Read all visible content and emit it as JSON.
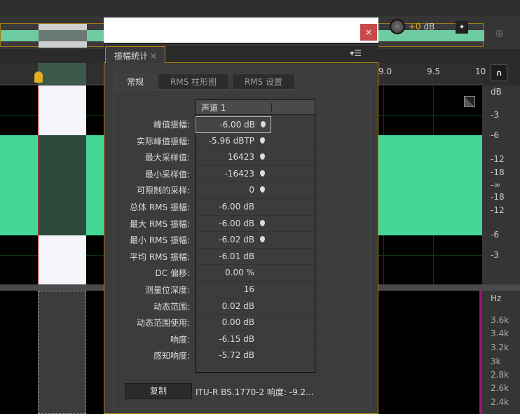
{
  "topbar": {
    "close_label": "×"
  },
  "mixer": {
    "gain_value": "+0",
    "gain_unit": " dB",
    "pin_icon": "pin-icon"
  },
  "ruler": {
    "labels": [
      "9.0",
      "9.5",
      "10"
    ]
  },
  "db_scale": {
    "unit": "dB",
    "labels": [
      "-3",
      "-6",
      "-12",
      "-18",
      "-∞",
      "-18",
      "-12",
      "-6",
      "-3"
    ]
  },
  "hz_scale": {
    "unit": "Hz",
    "labels": [
      "3.6k",
      "3.4k",
      "3.2k",
      "3k",
      "2.8k",
      "2.6k",
      "2.4k"
    ]
  },
  "panel": {
    "title": "振幅统计",
    "close": "×",
    "menu_icon": "▾☰",
    "tabs": [
      {
        "label": "常规"
      },
      {
        "label": "RMS 柱形图"
      },
      {
        "label": "RMS 设置"
      }
    ],
    "table": {
      "header": "声道 1",
      "rows": [
        {
          "label": "峰值振幅:",
          "value": "-6.00 dB",
          "marker": true
        },
        {
          "label": "实际峰值振幅:",
          "value": "-5.96 dBTP",
          "marker": true
        },
        {
          "label": "最大采样值:",
          "value": "16423",
          "marker": true
        },
        {
          "label": "最小采样值:",
          "value": "-16423",
          "marker": true
        },
        {
          "label": "可限制的采样:",
          "value": "0",
          "marker": true
        },
        {
          "label": "总体 RMS 振幅:",
          "value": "-6.00 dB",
          "marker": false
        },
        {
          "label": "最大 RMS 振幅:",
          "value": "-6.00 dB",
          "marker": true
        },
        {
          "label": "最小 RMS 振幅:",
          "value": "-6.02 dB",
          "marker": true
        },
        {
          "label": "平均 RMS 振幅:",
          "value": "-6.01 dB",
          "marker": false
        },
        {
          "label": "DC 偏移:",
          "value": "0.00 %",
          "marker": false
        },
        {
          "label": "测量位深度:",
          "value": "16",
          "marker": false
        },
        {
          "label": "动态范围:",
          "value": "0.02 dB",
          "marker": false
        },
        {
          "label": "动态范围使用:",
          "value": "0.00 dB",
          "marker": false
        },
        {
          "label": "响度:",
          "value": "-6.15 dB",
          "marker": false
        },
        {
          "label": "感知响度:",
          "value": "-5.72 dB",
          "marker": false
        }
      ]
    },
    "copy_label": "复制",
    "itu_text": "ITU-R BS.1770-2 响度: -9.2..."
  },
  "colors": {
    "waveform": "#44d795",
    "accent": "#b8860b",
    "close": "#c94a4a"
  }
}
